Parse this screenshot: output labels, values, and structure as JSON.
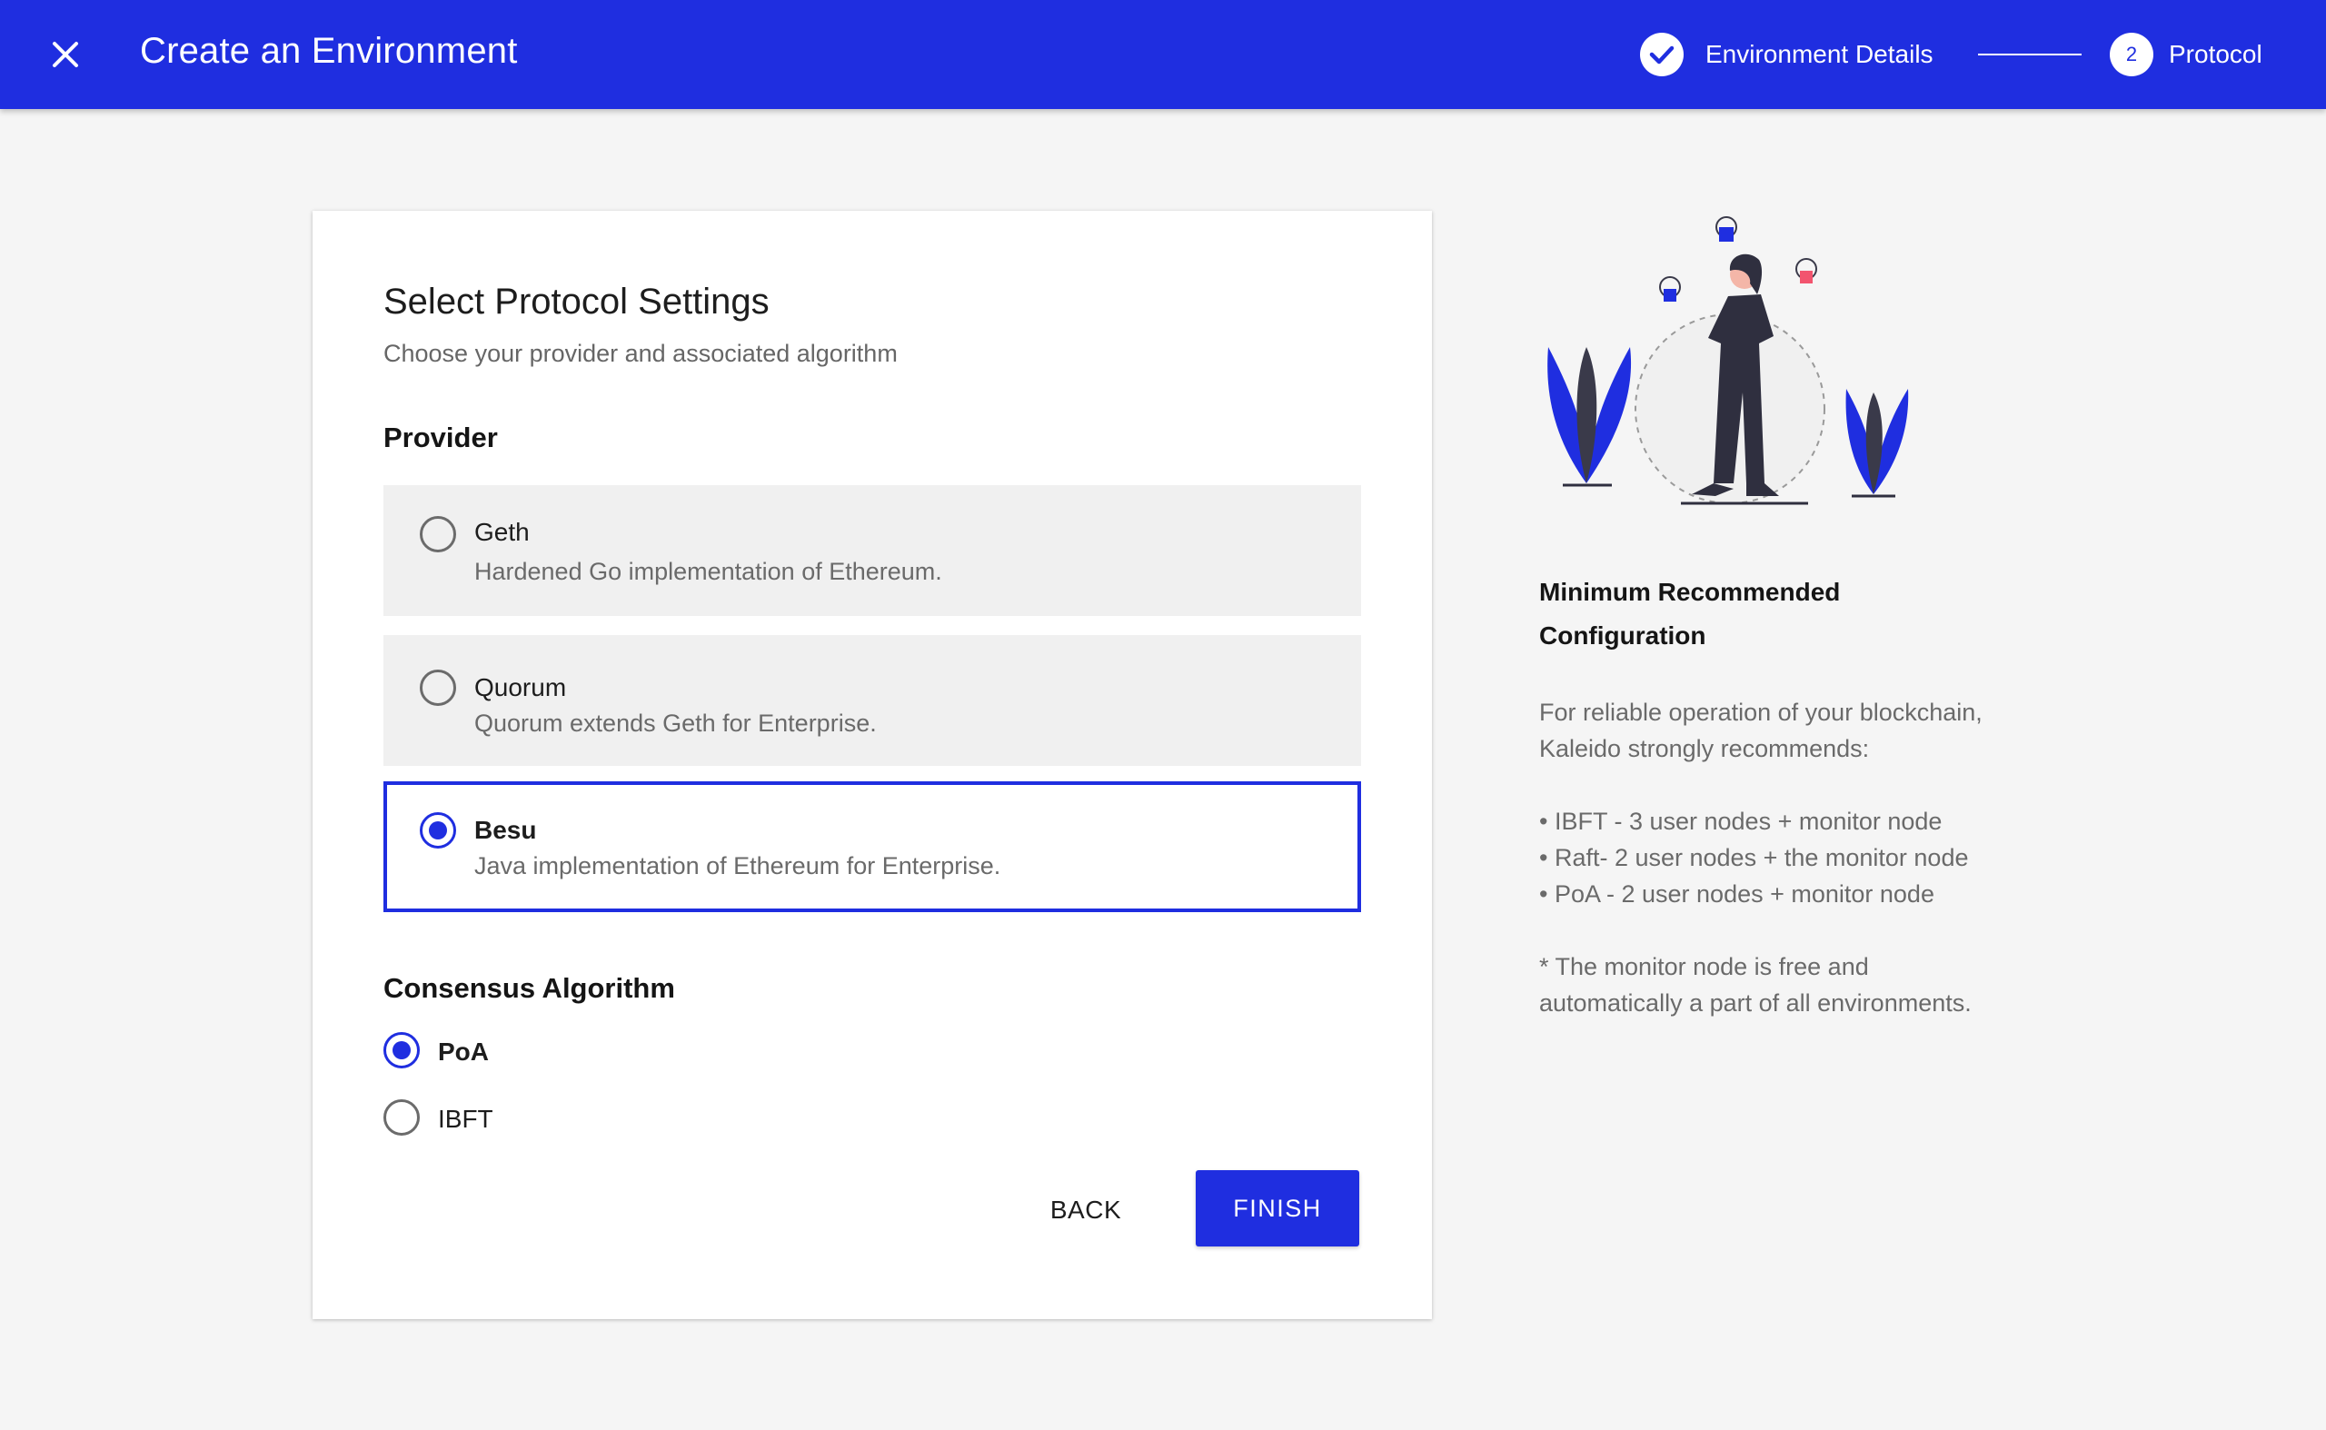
{
  "header": {
    "title": "Create an Environment",
    "steps": [
      {
        "label": "Environment Details",
        "state": "complete"
      },
      {
        "number": "2",
        "label": "Protocol",
        "state": "active"
      }
    ]
  },
  "card": {
    "title": "Select Protocol Settings",
    "subtitle": "Choose your provider and associated algorithm",
    "provider_heading": "Provider",
    "providers": [
      {
        "name": "Geth",
        "description": "Hardened Go implementation of Ethereum.",
        "selected": false
      },
      {
        "name": "Quorum",
        "description": "Quorum extends Geth for Enterprise.",
        "selected": false
      },
      {
        "name": "Besu",
        "description": "Java implementation of Ethereum for Enterprise.",
        "selected": true
      }
    ],
    "consensus_heading": "Consensus Algorithm",
    "algorithms": [
      {
        "label": "PoA",
        "selected": true
      },
      {
        "label": "IBFT",
        "selected": false
      }
    ],
    "back_label": "BACK",
    "finish_label": "FINISH"
  },
  "side": {
    "title_line1": "Minimum Recommended",
    "title_line2": "Configuration",
    "intro_line1": "For reliable operation of your blockchain,",
    "intro_line2": "Kaleido strongly recommends:",
    "bullets": [
      "• IBFT - 3 user nodes + monitor node",
      "• Raft- 2 user nodes + the monitor node",
      "• PoA - 2 user nodes + monitor node"
    ],
    "note_line1": "* The monitor node is free and",
    "note_line2": "automatically a part of all environments."
  },
  "colors": {
    "accent": "#1f2ee0",
    "background": "#f5f5f5",
    "option_bg": "#f0f0f0",
    "pink": "#f2546e"
  }
}
